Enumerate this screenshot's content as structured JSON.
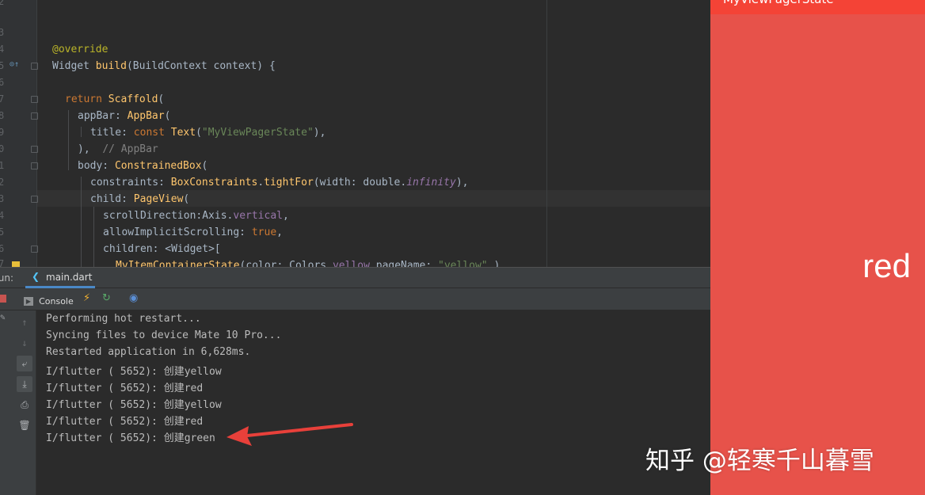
{
  "editor": {
    "line_numbers": [
      "2",
      "3",
      "4",
      "5",
      "6",
      "7",
      "8",
      "9",
      "0",
      "1",
      "2",
      "3",
      "4",
      "5",
      "6",
      "7"
    ],
    "lines": [
      {
        "text": "@override"
      },
      {
        "text": "Widget build(BuildContext context) {"
      },
      {
        "text": "return Scaffold("
      },
      {
        "text": "appBar: AppBar("
      },
      {
        "text": "title: const Text(\"MyViewPagerState\"),"
      },
      {
        "text": "),  // AppBar"
      },
      {
        "text": "body: ConstrainedBox("
      },
      {
        "text": "constraints: BoxConstraints.tightFor(width: double.infinity),"
      },
      {
        "text": "child: PageView("
      },
      {
        "text": "scrollDirection:Axis.vertical,"
      },
      {
        "text": "allowImplicitScrolling: true,"
      },
      {
        "text": "children: <Widget>["
      },
      {
        "text": "MyItemContainerState(color: Colors.yellow,pageName: \"yellow\",),"
      }
    ],
    "tokens": {
      "override": "@override",
      "widget": "Widget",
      "build": "build",
      "build_args": "(BuildContext context) {",
      "return": "return",
      "scaffold": "Scaffold",
      "appbar_key": "appBar: ",
      "appbar_fn": "AppBar",
      "title_key": "title: ",
      "const": "const ",
      "text_fn": "Text",
      "title_str": "\"MyViewPagerState\"",
      "close_paren": "),",
      "comment_appbar": "// AppBar",
      "body_key": "body: ",
      "constrained": "ConstrainedBox",
      "constraints_key": "constraints: ",
      "box_constraints": "BoxConstraints",
      "tight_for": "tightFor",
      "width_arg": "(width: double.",
      "infinity": "infinity",
      "child_key": "child: ",
      "pageview": "PageView",
      "scroll_dir": "scrollDirection:Axis.",
      "vertical": "vertical",
      "allow_implicit": "allowImplicitScrolling: ",
      "true": "true",
      "children_key": "children: ",
      "widget_list": "<Widget>[",
      "item_state": "MyItemContainerState",
      "item_args": "(color: Colors.",
      "yellow": "yellow",
      "pagename": ",pageName: ",
      "yellow_str": "\"yellow\"",
      "item_end": ",),"
    }
  },
  "run_bar": {
    "label": "Run:",
    "tab": "main.dart"
  },
  "toolbar": {
    "console_tab": "Console"
  },
  "console": {
    "lines": [
      "Performing hot restart...",
      "Syncing files to device Mate 10 Pro...",
      "Restarted application in 6,628ms.",
      "I/flutter ( 5652): 创建yellow",
      "I/flutter ( 5652): 创建red",
      "I/flutter ( 5652): 创建yellow",
      "I/flutter ( 5652): 创建red",
      "I/flutter ( 5652): 创建green"
    ]
  },
  "device": {
    "appbar_title": "MyViewPagerState",
    "page_label": "red",
    "colors": {
      "page": "#e7524a",
      "appbar": "#f44336"
    }
  },
  "watermark": "知乎 @轻寒千山暮雪",
  "icons": [
    "bookmark-icon",
    "stop-icon",
    "pin-icon",
    "console-icon",
    "flutter-icon",
    "hot-reload-icon",
    "hot-restart-icon",
    "devtools-icon",
    "up-arrow-icon",
    "down-arrow-icon",
    "soft-wrap-icon",
    "scroll-to-end-icon",
    "print-icon",
    "trash-icon"
  ]
}
